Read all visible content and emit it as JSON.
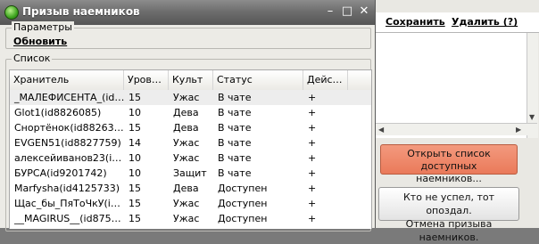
{
  "window": {
    "title": "Призыв наемников",
    "minimize": "–",
    "maximize": "□",
    "close": "✕"
  },
  "params": {
    "label": "Параметры",
    "refresh": "Обновить"
  },
  "list": {
    "label": "Список",
    "columns": [
      "Хранитель",
      "Уров…",
      "Культ",
      "Статус",
      "Дейс…"
    ],
    "rows": [
      {
        "name": "_МАЛЕФИСЕНТА_(id…",
        "level": "15",
        "cult": "Ужас",
        "status": "В чате",
        "action": "+"
      },
      {
        "name": "Glot1(id8826085)",
        "level": "10",
        "cult": "Дева",
        "status": "В чате",
        "action": "+"
      },
      {
        "name": "Снортёнок(id88263…",
        "level": "15",
        "cult": "Дева",
        "status": "В чате",
        "action": "+"
      },
      {
        "name": "EVGEN51(id8827759)",
        "level": "14",
        "cult": "Ужас",
        "status": "В чате",
        "action": "+"
      },
      {
        "name": "алексейиванов23(i…",
        "level": "10",
        "cult": "Ужас",
        "status": "В чате",
        "action": "+"
      },
      {
        "name": "БУРСА(id9201742)",
        "level": "10",
        "cult": "Защит",
        "status": "В чате",
        "action": "+"
      },
      {
        "name": "Marfysha(id4125733)",
        "level": "15",
        "cult": "Дева",
        "status": "Доступен",
        "action": "+"
      },
      {
        "name": "Щас_бы_ПяТоЧкУ(i…",
        "level": "15",
        "cult": "Ужас",
        "status": "Доступен",
        "action": "+"
      },
      {
        "name": "__MAGIRUS__(id875…",
        "level": "15",
        "cult": "Ужас",
        "status": "Доступен",
        "action": "+"
      }
    ]
  },
  "side": {
    "save": "Сохранить",
    "delete": "Удалить (?)",
    "open_list_line1": "Открыть список доступных",
    "open_list_line2": "наемников...",
    "late_line1": "Кто не успел, тот опоздал.",
    "late_line2": "Отмена призыва наемников."
  },
  "colors": {
    "accent_button": "#ea7a5a",
    "title_bar": "#6e6e6e"
  }
}
